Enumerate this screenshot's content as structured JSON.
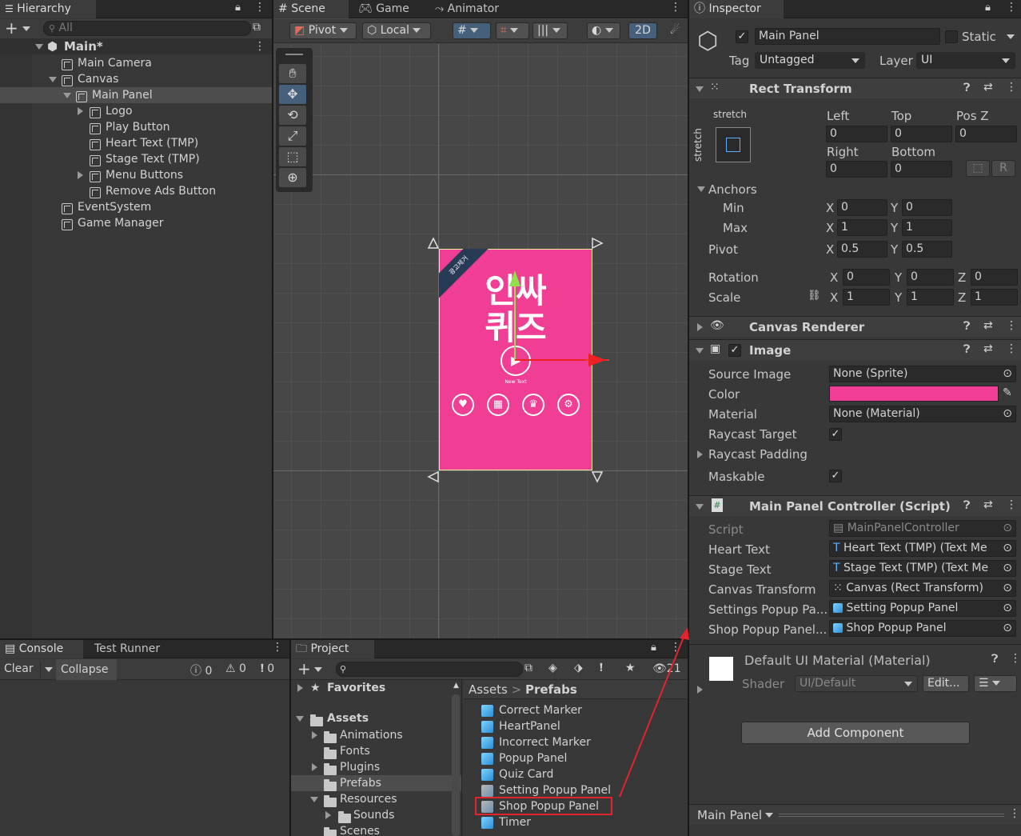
{
  "hierarchy": {
    "tab": "Hierarchy",
    "search_placeholder": "All",
    "scene": "Main*",
    "items": [
      "Main Camera",
      "Canvas",
      "Main Panel",
      "Logo",
      "Play Button",
      "Heart Text (TMP)",
      "Stage Text (TMP)",
      "Menu Buttons",
      "Remove Ads Button",
      "EventSystem",
      "Game Manager"
    ]
  },
  "scene_tabs": [
    "Scene",
    "Game",
    "Animator"
  ],
  "scene_toolbar": {
    "pivot": "Pivot",
    "local": "Local",
    "mode_2d": "2D"
  },
  "game_preview": {
    "corner_banner": "광고제거",
    "title_line1": "인싸",
    "title_line2": "퀴즈",
    "small_text": "New Text",
    "bg_color": "#ef3e93"
  },
  "inspector": {
    "tab": "Inspector",
    "object_name": "Main Panel",
    "static_label": "Static",
    "tag_label": "Tag",
    "tag_value": "Untagged",
    "layer_label": "Layer",
    "layer_value": "UI",
    "rect": {
      "title": "Rect Transform",
      "stretch_top": "stretch",
      "stretch_side": "stretch",
      "left": "Left",
      "top": "Top",
      "posz": "Pos Z",
      "right": "Right",
      "bottom": "Bottom",
      "v_left": "0",
      "v_top": "0",
      "v_posz": "0",
      "v_right": "0",
      "v_bottom": "0",
      "r_btn": "R",
      "anchors": "Anchors",
      "min": "Min",
      "max": "Max",
      "pivot": "Pivot",
      "rotation": "Rotation",
      "scale": "Scale",
      "min_x": "0",
      "min_y": "0",
      "max_x": "1",
      "max_y": "1",
      "pivot_x": "0.5",
      "pivot_y": "0.5",
      "rot_x": "0",
      "rot_y": "0",
      "rot_z": "0",
      "scale_x": "1",
      "scale_y": "1",
      "scale_z": "1",
      "x": "X",
      "y": "Y",
      "z": "Z"
    },
    "canvas_renderer": "Canvas Renderer",
    "image": {
      "title": "Image",
      "source_image": "Source Image",
      "source_value": "None (Sprite)",
      "color": "Color",
      "color_value": "#ef3e93",
      "material": "Material",
      "material_value": "None (Material)",
      "raycast_target": "Raycast Target",
      "raycast_padding": "Raycast Padding",
      "maskable": "Maskable"
    },
    "script": {
      "title": "Main Panel Controller (Script)",
      "script_label": "Script",
      "script_value": "MainPanelController",
      "fields": [
        {
          "label": "Heart Text",
          "value": "Heart Text (TMP) (Text Me"
        },
        {
          "label": "Stage Text",
          "value": "Stage Text (TMP) (Text Me"
        },
        {
          "label": "Canvas Transform",
          "value": "Canvas (Rect Transform)"
        },
        {
          "label": "Settings Popup Pa...",
          "value": "Setting Popup Panel"
        },
        {
          "label": "Shop Popup Panel...",
          "value": "Shop Popup Panel"
        }
      ]
    },
    "material": {
      "title": "Default UI Material (Material)",
      "shader_label": "Shader",
      "shader_value": "UI/Default",
      "edit": "Edit..."
    },
    "add_component": "Add Component",
    "footer": "Main Panel"
  },
  "console": {
    "tab": "Console",
    "tab2": "Test Runner",
    "clear": "Clear",
    "collapse": "Collapse",
    "count_log": "0",
    "count_warn": "0",
    "count_err": "0"
  },
  "project": {
    "tab": "Project",
    "count": "21",
    "favorites": "Favorites",
    "assets": "Assets",
    "folders": [
      "Animations",
      "Fonts",
      "Plugins",
      "Prefabs",
      "Resources",
      "Sounds",
      "Scenes"
    ],
    "breadcrumb_root": "Assets",
    "breadcrumb_sep": ">",
    "breadcrumb_leaf": "Prefabs",
    "prefabs": [
      "Correct Marker",
      "HeartPanel",
      "Incorrect Marker",
      "Popup Panel",
      "Quiz Card",
      "Setting Popup Panel",
      "Shop Popup Panel",
      "Timer"
    ]
  },
  "colors": {
    "annotation_red": "#e0252c",
    "selection": "#2c5d87",
    "panel_bg": "#383838"
  }
}
